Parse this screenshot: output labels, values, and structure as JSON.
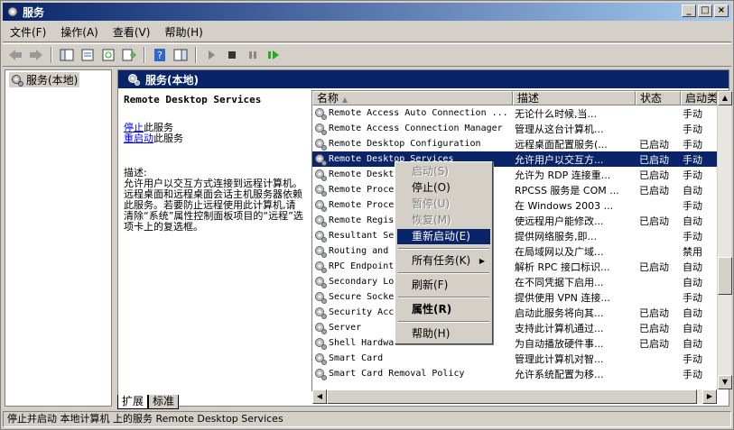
{
  "window": {
    "title": "服务",
    "min": "_",
    "max": "□",
    "close": "×"
  },
  "menu": [
    "文件(F)",
    "操作(A)",
    "查看(V)",
    "帮助(H)"
  ],
  "tree": {
    "item": "服务(本地)"
  },
  "main": {
    "header": "服务(本地)"
  },
  "desc": {
    "name": "Remote Desktop Services",
    "stop_link": "停止",
    "stop_suffix": "此服务",
    "restart_link": "重启动",
    "restart_suffix": "此服务",
    "label": "描述:",
    "text": "允许用户以交互方式连接到远程计算机。远程桌面和远程桌面会话主机服务器依赖此服务。若要防止远程使用此计算机,请清除“系统”属性控制面板项目的“远程”选项卡上的复选框。"
  },
  "columns": [
    "名称",
    "描述",
    "状态",
    "启动类"
  ],
  "rows": [
    {
      "name": "Remote Access Auto Connection ...",
      "desc": "无论什么时候,当...",
      "status": "",
      "start": "手动"
    },
    {
      "name": "Remote Access Connection Manager",
      "desc": "管理从这台计算机...",
      "status": "",
      "start": "手动"
    },
    {
      "name": "Remote Desktop Configuration",
      "desc": "远程桌面配置服务(...",
      "status": "已启动",
      "start": "手动"
    },
    {
      "name": "Remote Desktop Services",
      "desc": "允许用户以交互方...",
      "status": "已启动",
      "start": "手动"
    },
    {
      "name": "Remote Deskt",
      "desc": "允许为 RDP 连接重...",
      "status": "已启动",
      "start": "手动"
    },
    {
      "name": "Remote Proce",
      "desc": "RPCSS 服务是 COM ...",
      "status": "已启动",
      "start": "自动"
    },
    {
      "name": "Remote Proce",
      "desc": "在 Windows 2003 ...",
      "status": "",
      "start": "手动"
    },
    {
      "name": "Remote Regis",
      "desc": "使远程用户能修改...",
      "status": "已启动",
      "start": "自动"
    },
    {
      "name": "Resultant Se",
      "desc": "提供网络服务,即...",
      "status": "",
      "start": "手动"
    },
    {
      "name": "Routing and",
      "desc": "在局域网以及广域...",
      "status": "",
      "start": "禁用"
    },
    {
      "name": "RPC Endpoint",
      "desc": "解析 RPC 接口标识...",
      "status": "已启动",
      "start": "自动"
    },
    {
      "name": "Secondary Lo",
      "desc": "在不同凭据下启用...",
      "status": "",
      "start": "自动"
    },
    {
      "name": "Secure Socke",
      "desc": "提供使用 VPN 连接...",
      "status": "",
      "start": "手动"
    },
    {
      "name": "Security Acc",
      "desc": "启动此服务将向其...",
      "status": "已启动",
      "start": "自动"
    },
    {
      "name": "Server",
      "desc": "支持此计算机通过...",
      "status": "已启动",
      "start": "自动"
    },
    {
      "name": "Shell Hardwa",
      "desc": "为自动播放硬件事...",
      "status": "已启动",
      "start": "自动"
    },
    {
      "name": "Smart Card",
      "desc": "管理此计算机对智...",
      "status": "",
      "start": "手动"
    },
    {
      "name": "Smart Card Removal Policy",
      "desc": "允许系统配置为移...",
      "status": "",
      "start": "手动"
    }
  ],
  "context_menu": [
    "启动(S)",
    "停止(O)",
    "暂停(U)",
    "恢复(M)",
    "重新启动(E)",
    "所有任务(K)",
    "刷新(F)",
    "属性(R)",
    "帮助(H)"
  ],
  "tabs": [
    "扩展",
    "标准"
  ],
  "status": "停止并启动 本地计算机 上的服务 Remote Desktop Services"
}
